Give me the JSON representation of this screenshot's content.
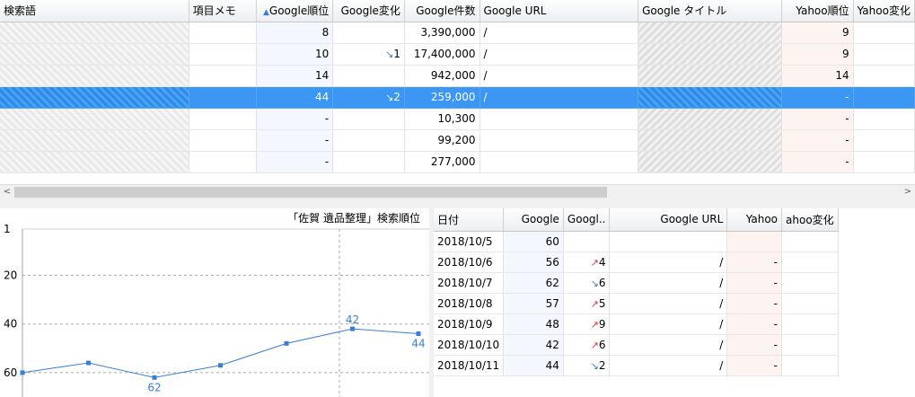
{
  "keyword_table": {
    "columns": [
      "検索語",
      "項目メモ",
      "Google順位",
      "Google変化",
      "Google件数",
      "Google URL",
      "Google タイトル",
      "Yahoo順位",
      "Yahoo変化"
    ],
    "sort_indicator": "▲",
    "rows": [
      {
        "memo": "",
        "g_rank": "8",
        "g_change": "",
        "g_change_dir": "",
        "g_count": "3,390,000",
        "g_url": "/",
        "y_rank": "9"
      },
      {
        "memo": "",
        "g_rank": "10",
        "g_change": "1",
        "g_change_dir": "down",
        "g_count": "17,400,000",
        "g_url": "/",
        "y_rank": "9"
      },
      {
        "memo": "",
        "g_rank": "14",
        "g_change": "",
        "g_change_dir": "",
        "g_count": "942,000",
        "g_url": "/",
        "y_rank": "14"
      },
      {
        "memo": "",
        "g_rank": "44",
        "g_change": "2",
        "g_change_dir": "down",
        "g_count": "259,000",
        "g_url": "/",
        "y_rank": "-",
        "selected": true
      },
      {
        "memo": "",
        "g_rank": "-",
        "g_change": "",
        "g_change_dir": "",
        "g_count": "10,300",
        "g_url": "",
        "y_rank": "-"
      },
      {
        "memo": "",
        "g_rank": "-",
        "g_change": "",
        "g_change_dir": "",
        "g_count": "99,200",
        "g_url": "",
        "y_rank": "-"
      },
      {
        "memo": "",
        "g_rank": "-",
        "g_change": "",
        "g_change_dir": "",
        "g_count": "277,000",
        "g_url": "",
        "y_rank": "-"
      }
    ]
  },
  "scrollbar": {
    "left_arrow": "<",
    "right_arrow": ">"
  },
  "chart_data": {
    "type": "line",
    "title": "「佐賀 遺品整理」検索順位",
    "y_inverted": true,
    "ylim": [
      1,
      70
    ],
    "yticks": [
      "1",
      "20",
      "40",
      "60"
    ],
    "grid": true,
    "series": [
      {
        "values": [
          60,
          56,
          62,
          57,
          48,
          42,
          44
        ],
        "labeled": [
          false,
          false,
          true,
          false,
          false,
          true,
          true
        ]
      }
    ],
    "color": "#3a7dd8"
  },
  "history_table": {
    "columns": [
      "日付",
      "Google",
      "Googl..",
      "Google URL",
      "Yahoo",
      "ahoo変化"
    ],
    "rows": [
      {
        "date": "2018/10/5",
        "rank": "60",
        "change": "",
        "dir": "",
        "url": "",
        "yahoo": "",
        "ychange": ""
      },
      {
        "date": "2018/10/6",
        "rank": "56",
        "change": "4",
        "dir": "up",
        "url": "/",
        "yahoo": "-",
        "ychange": ""
      },
      {
        "date": "2018/10/7",
        "rank": "62",
        "change": "6",
        "dir": "down",
        "url": "/",
        "yahoo": "-",
        "ychange": ""
      },
      {
        "date": "2018/10/8",
        "rank": "57",
        "change": "5",
        "dir": "up",
        "url": "/",
        "yahoo": "-",
        "ychange": ""
      },
      {
        "date": "2018/10/9",
        "rank": "48",
        "change": "9",
        "dir": "up",
        "url": "/",
        "yahoo": "-",
        "ychange": ""
      },
      {
        "date": "2018/10/10",
        "rank": "42",
        "change": "6",
        "dir": "up",
        "url": "/",
        "yahoo": "-",
        "ychange": ""
      },
      {
        "date": "2018/10/11",
        "rank": "44",
        "change": "2",
        "dir": "down",
        "url": "/",
        "yahoo": "-",
        "ychange": ""
      }
    ]
  },
  "icons": {
    "arrow_up": "↗",
    "arrow_down": "↘"
  }
}
